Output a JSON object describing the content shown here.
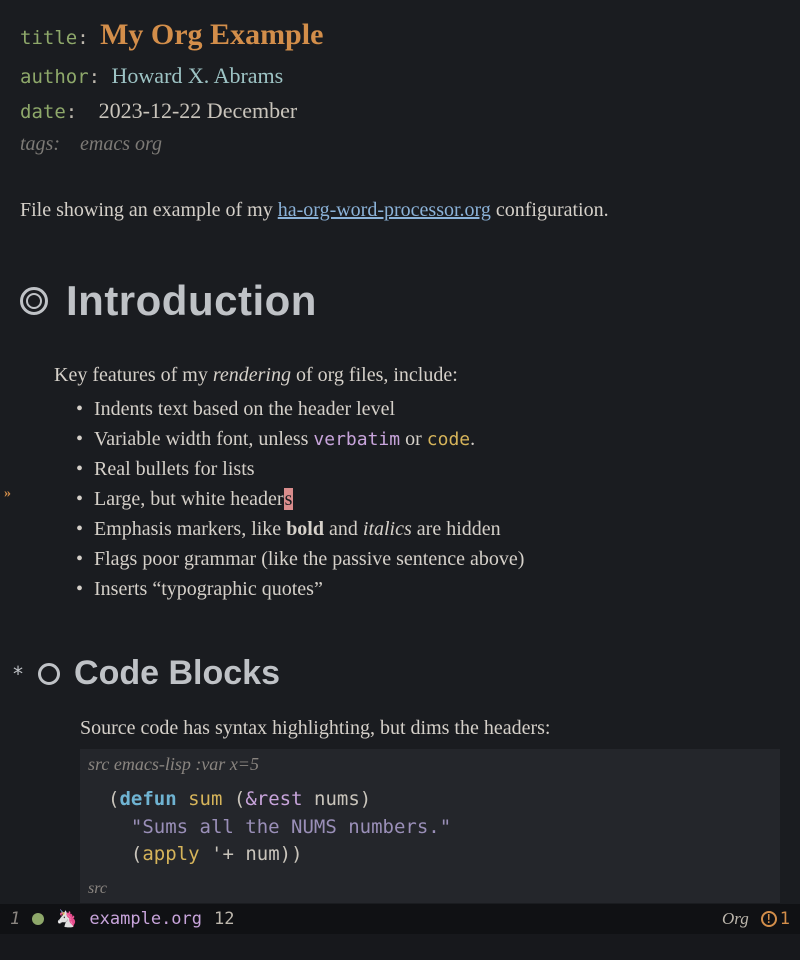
{
  "meta": {
    "title_key": "title",
    "title_val": "My Org Example",
    "author_key": "author",
    "author_val": "Howard X. Abrams",
    "date_key": "date",
    "date_val": "2023-12-22 December",
    "tags_key": "tags:",
    "tags_val": "emacs org"
  },
  "intro": {
    "pre": "File showing an example of my ",
    "link": "ha-org-word-processor.org",
    "post": " configuration."
  },
  "h1": "Introduction",
  "features_lead_pre": "Key features of my ",
  "features_lead_em": "rendering",
  "features_lead_post": " of org files, include:",
  "features": {
    "f0": "Indents text based on the header level",
    "f1_pre": "Variable width font, unless ",
    "f1_verb": "verbatim",
    "f1_mid": " or ",
    "f1_code": "code",
    "f1_post": ".",
    "f2": "Real bullets for lists",
    "f3_pre": "Large, but white header",
    "f3_cursor": "s",
    "f4_pre": "Emphasis markers, like ",
    "f4_bold": "bold",
    "f4_mid": " and ",
    "f4_ital": "italics ",
    "f4_post": "are hidden",
    "f5": "Flags poor grammar (like the passive sentence above)",
    "f6": "Inserts “typographic quotes”"
  },
  "h2_star": "*",
  "h2": "Code Blocks",
  "src_intro": "Source code has syntax highlighting, but dims the headers:",
  "src_header_pre": "src ",
  "src_header_lang": "emacs-lisp :var x=5",
  "code": {
    "l1_open": "(",
    "l1_defun": "defun",
    "l1_sp1": " ",
    "l1_name": "sum",
    "l1_sp2": " ",
    "l1_p2": "(",
    "l1_rest": "&rest",
    "l1_sp3": " ",
    "l1_arg": "nums",
    "l1_p3": ")",
    "l2": "\"Sums all the NUMS numbers.\"",
    "l3_p1": "(",
    "l3_apply": "apply",
    "l3_sp1": " ",
    "l3_quote": "'+",
    "l3_sp2": " ",
    "l3_num": "num",
    "l3_close": "))"
  },
  "src_footer": "src",
  "modeline": {
    "winnum": "1",
    "file": "example.org",
    "line": "12",
    "mode": "Org",
    "warn_count": "1"
  },
  "fringe_arrow": "»"
}
